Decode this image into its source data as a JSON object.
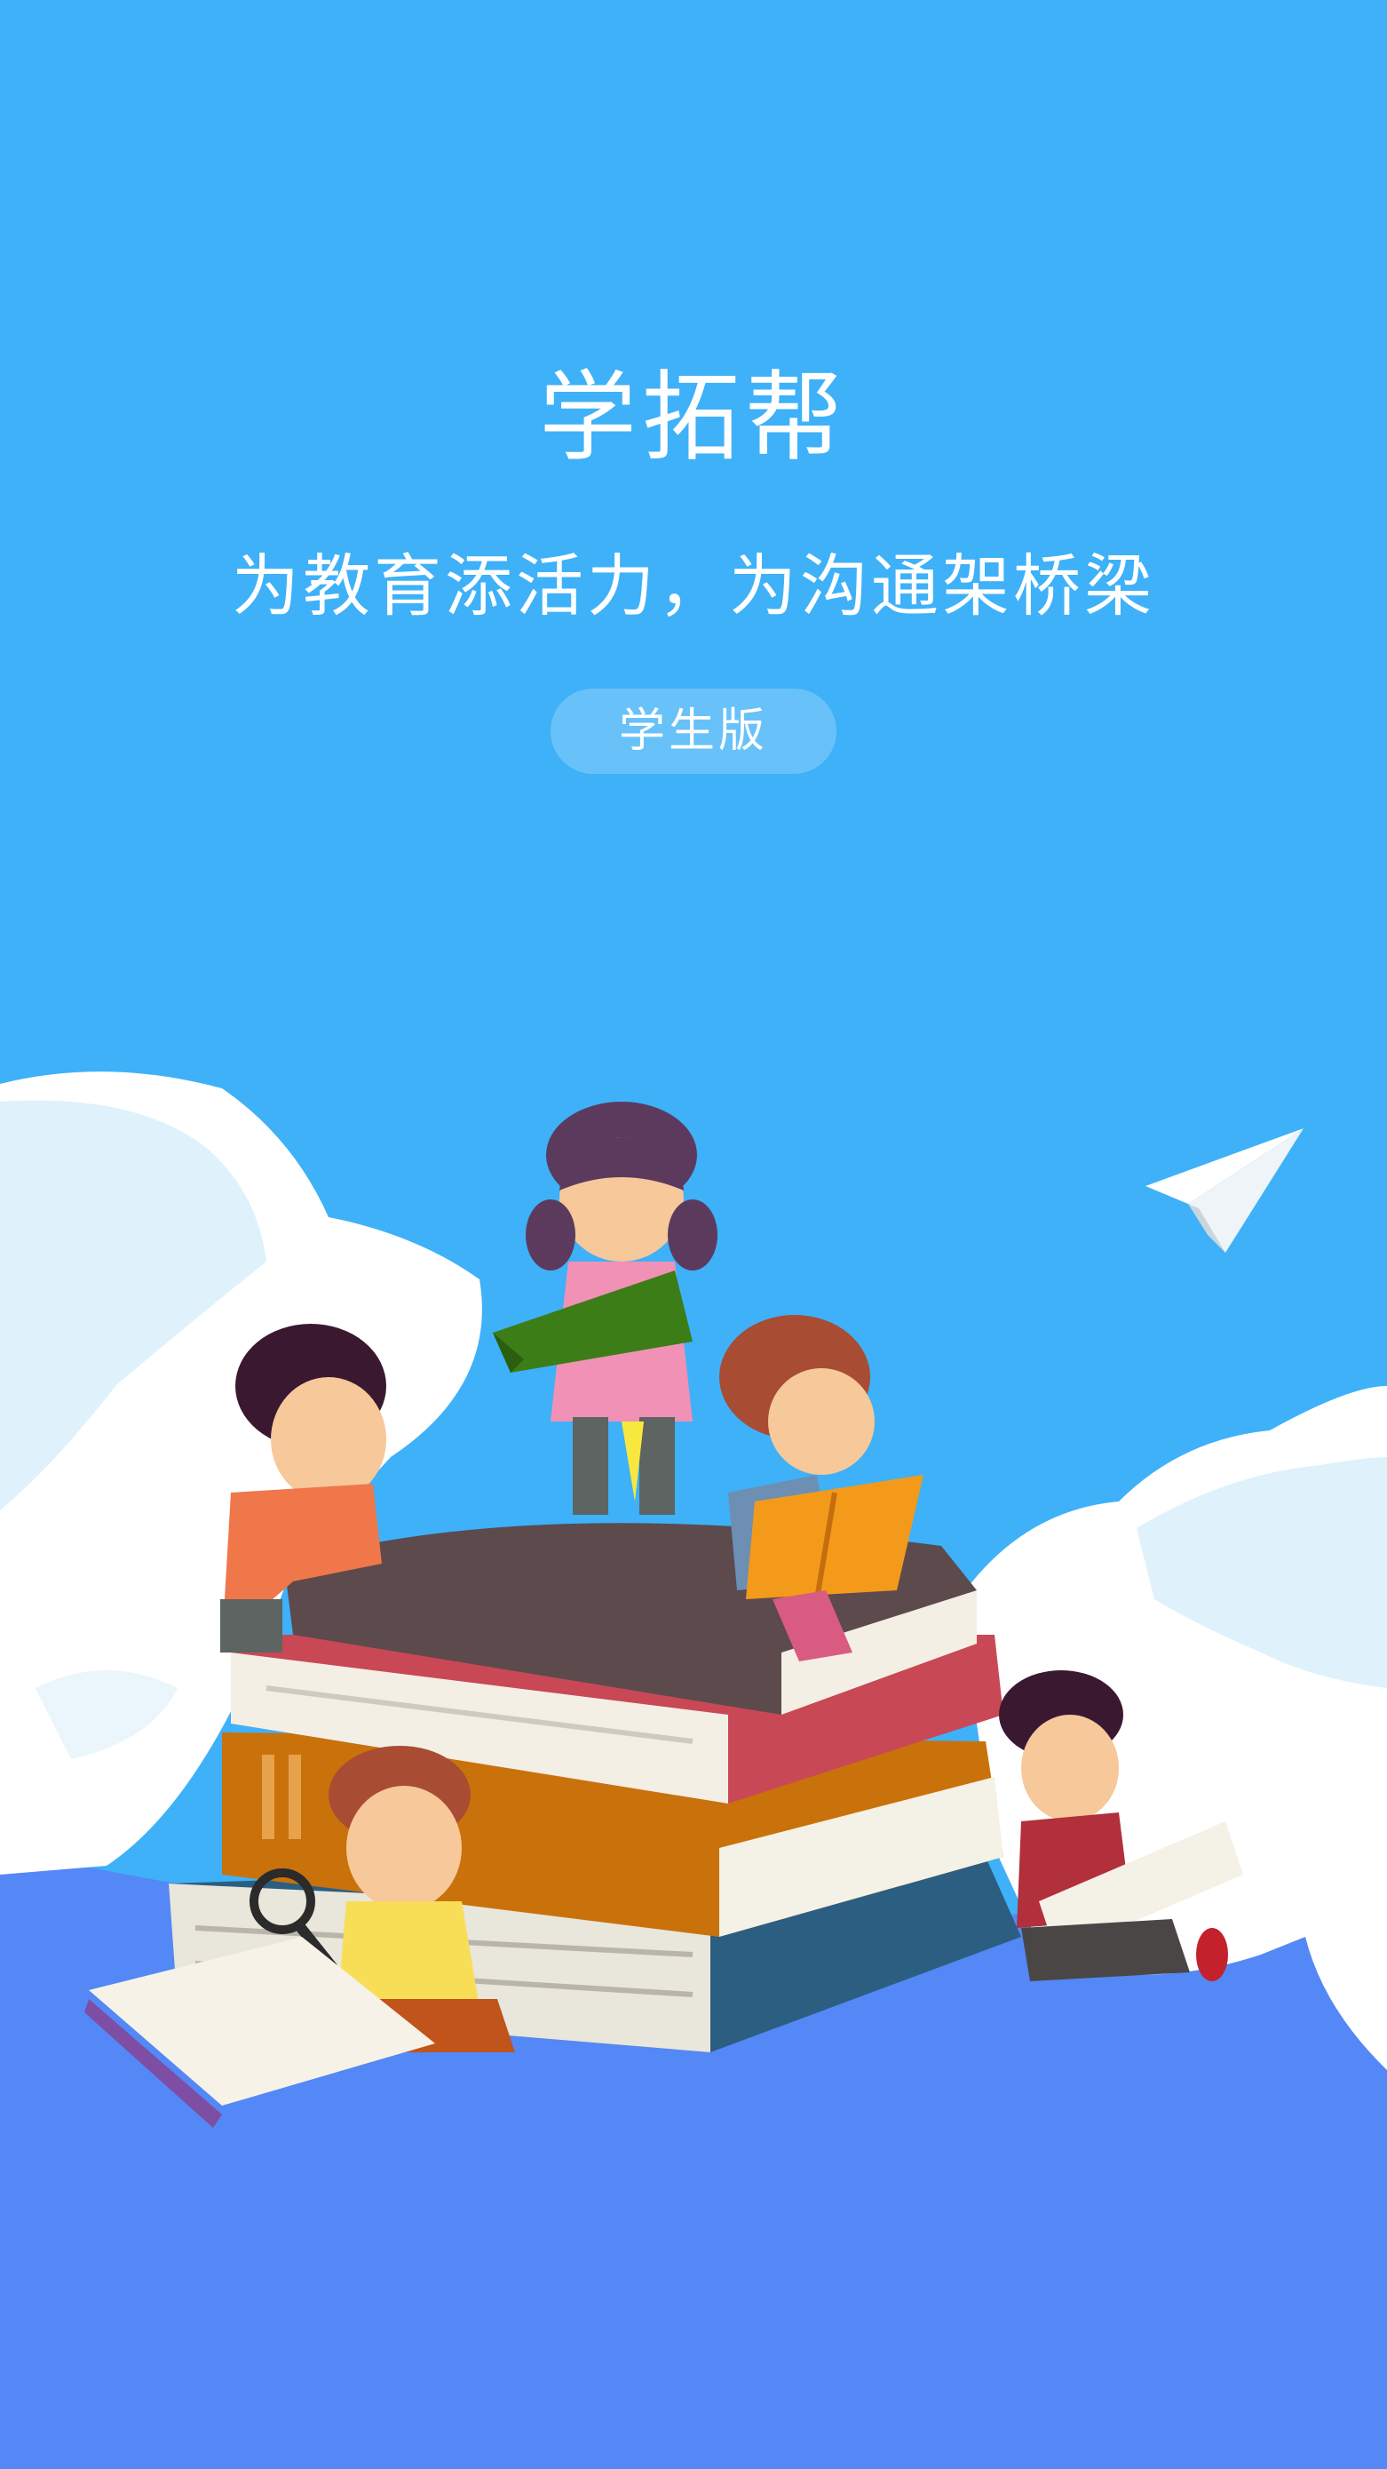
{
  "app": {
    "title": "学拓帮",
    "slogan": "为教育添活力，为沟通架桥梁",
    "edition_badge": "学生版"
  },
  "colors": {
    "sky": "#3eb1f8",
    "bottom": "#5388f6",
    "cloud": "#ffffff",
    "cloud_shade": "#dff1fb",
    "text": "#ffffff"
  },
  "illustration": {
    "scene": "children-reading-on-book-stack",
    "icons": [
      "paper-plane-icon"
    ]
  }
}
